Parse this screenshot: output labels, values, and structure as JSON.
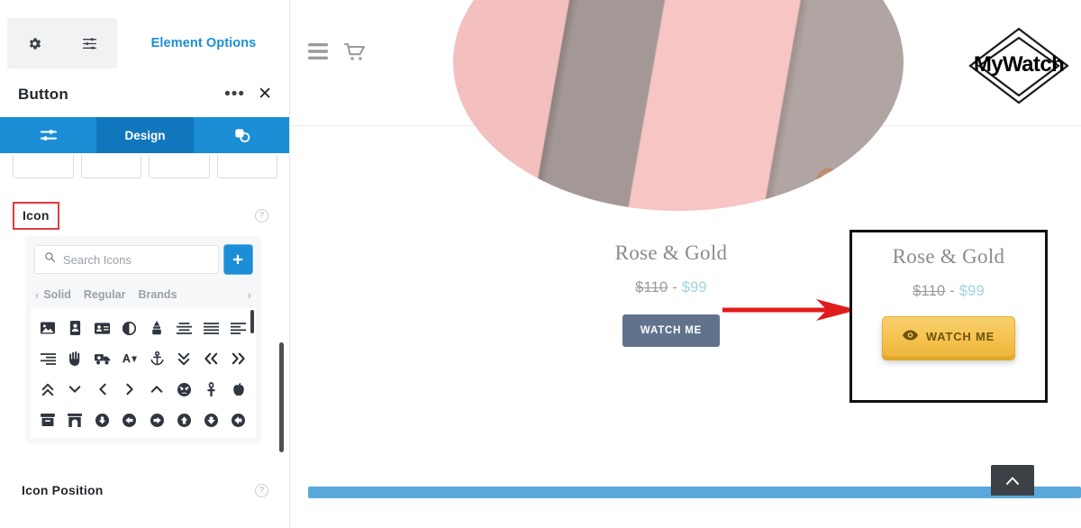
{
  "sidebar": {
    "toolbar": {
      "gear_icon": "gear-icon",
      "sliders_icon": "sliders-icon"
    },
    "element_options_label": "Element Options",
    "panel_title": "Button",
    "more_label": "•••",
    "close_label": "✕",
    "tabs": [
      {
        "label": "",
        "icon": "settings-sliders-icon",
        "active": false
      },
      {
        "label": "Design",
        "icon": "",
        "active": true
      },
      {
        "label": "",
        "icon": "layers-copy-icon",
        "active": false
      }
    ],
    "sections": [
      {
        "label": "Icon",
        "highlighted": true,
        "help": "?"
      },
      {
        "label": "Icon Position",
        "highlighted": false,
        "help": "?"
      }
    ],
    "icon_picker": {
      "search_placeholder": "Search Icons",
      "search_value": "",
      "add_button_label": "+",
      "prev_label": "‹",
      "next_label": "›",
      "categories": [
        "Solid",
        "Regular",
        "Brands"
      ],
      "icons": [
        "image-icon",
        "address-book-icon",
        "address-card-icon",
        "adjust-icon",
        "air-freshener-icon",
        "align-center-icon",
        "align-justify-icon",
        "align-left-icon",
        "align-right-icon",
        "allergies-icon",
        "ambulance-icon",
        "american-sign-language-icon",
        "anchor-icon",
        "angle-double-down-icon",
        "angle-double-left-icon",
        "angle-double-right-icon",
        "angle-double-up-icon",
        "angle-down-icon",
        "angle-left-icon",
        "angle-right-icon",
        "angle-up-icon",
        "angry-icon",
        "ankh-icon",
        "apple-alt-icon",
        "archive-icon",
        "archway-icon",
        "arrow-circle-down-icon",
        "arrow-circle-left-icon",
        "arrow-circle-right-icon",
        "arrow-circle-up-icon",
        "arrow-alt-circle-down-icon",
        "arrow-alt-circle-left-icon"
      ]
    }
  },
  "preview": {
    "header": {
      "menu_icon": "hamburger-menu-icon",
      "cart_icon": "shopping-cart-icon",
      "logo_text": "MyWatch"
    },
    "product_image_alt": "rose-gold-watch-photo",
    "variant_plain": {
      "title": "Rose & Gold",
      "price_old": "$110",
      "price_separator": "-",
      "price_new": "$99",
      "button_label": "WATCH ME"
    },
    "variant_highlight": {
      "title": "Rose & Gold",
      "price_old": "$110",
      "price_separator": "-",
      "price_new": "$99",
      "button_label": "WATCH ME",
      "button_icon": "eye-icon"
    },
    "annotation_arrow": "red-right-arrow",
    "scroll_to_top_label": "⌃"
  },
  "colors": {
    "accent_blue": "#1b8ed6",
    "tab_active_blue": "#1177bd",
    "highlight_red": "#e03b3b",
    "gold": "#f6c451",
    "price_new_teal": "#9fd4dd",
    "plain_button": "#61738c",
    "bottom_bar_blue": "#5aa9dd"
  }
}
